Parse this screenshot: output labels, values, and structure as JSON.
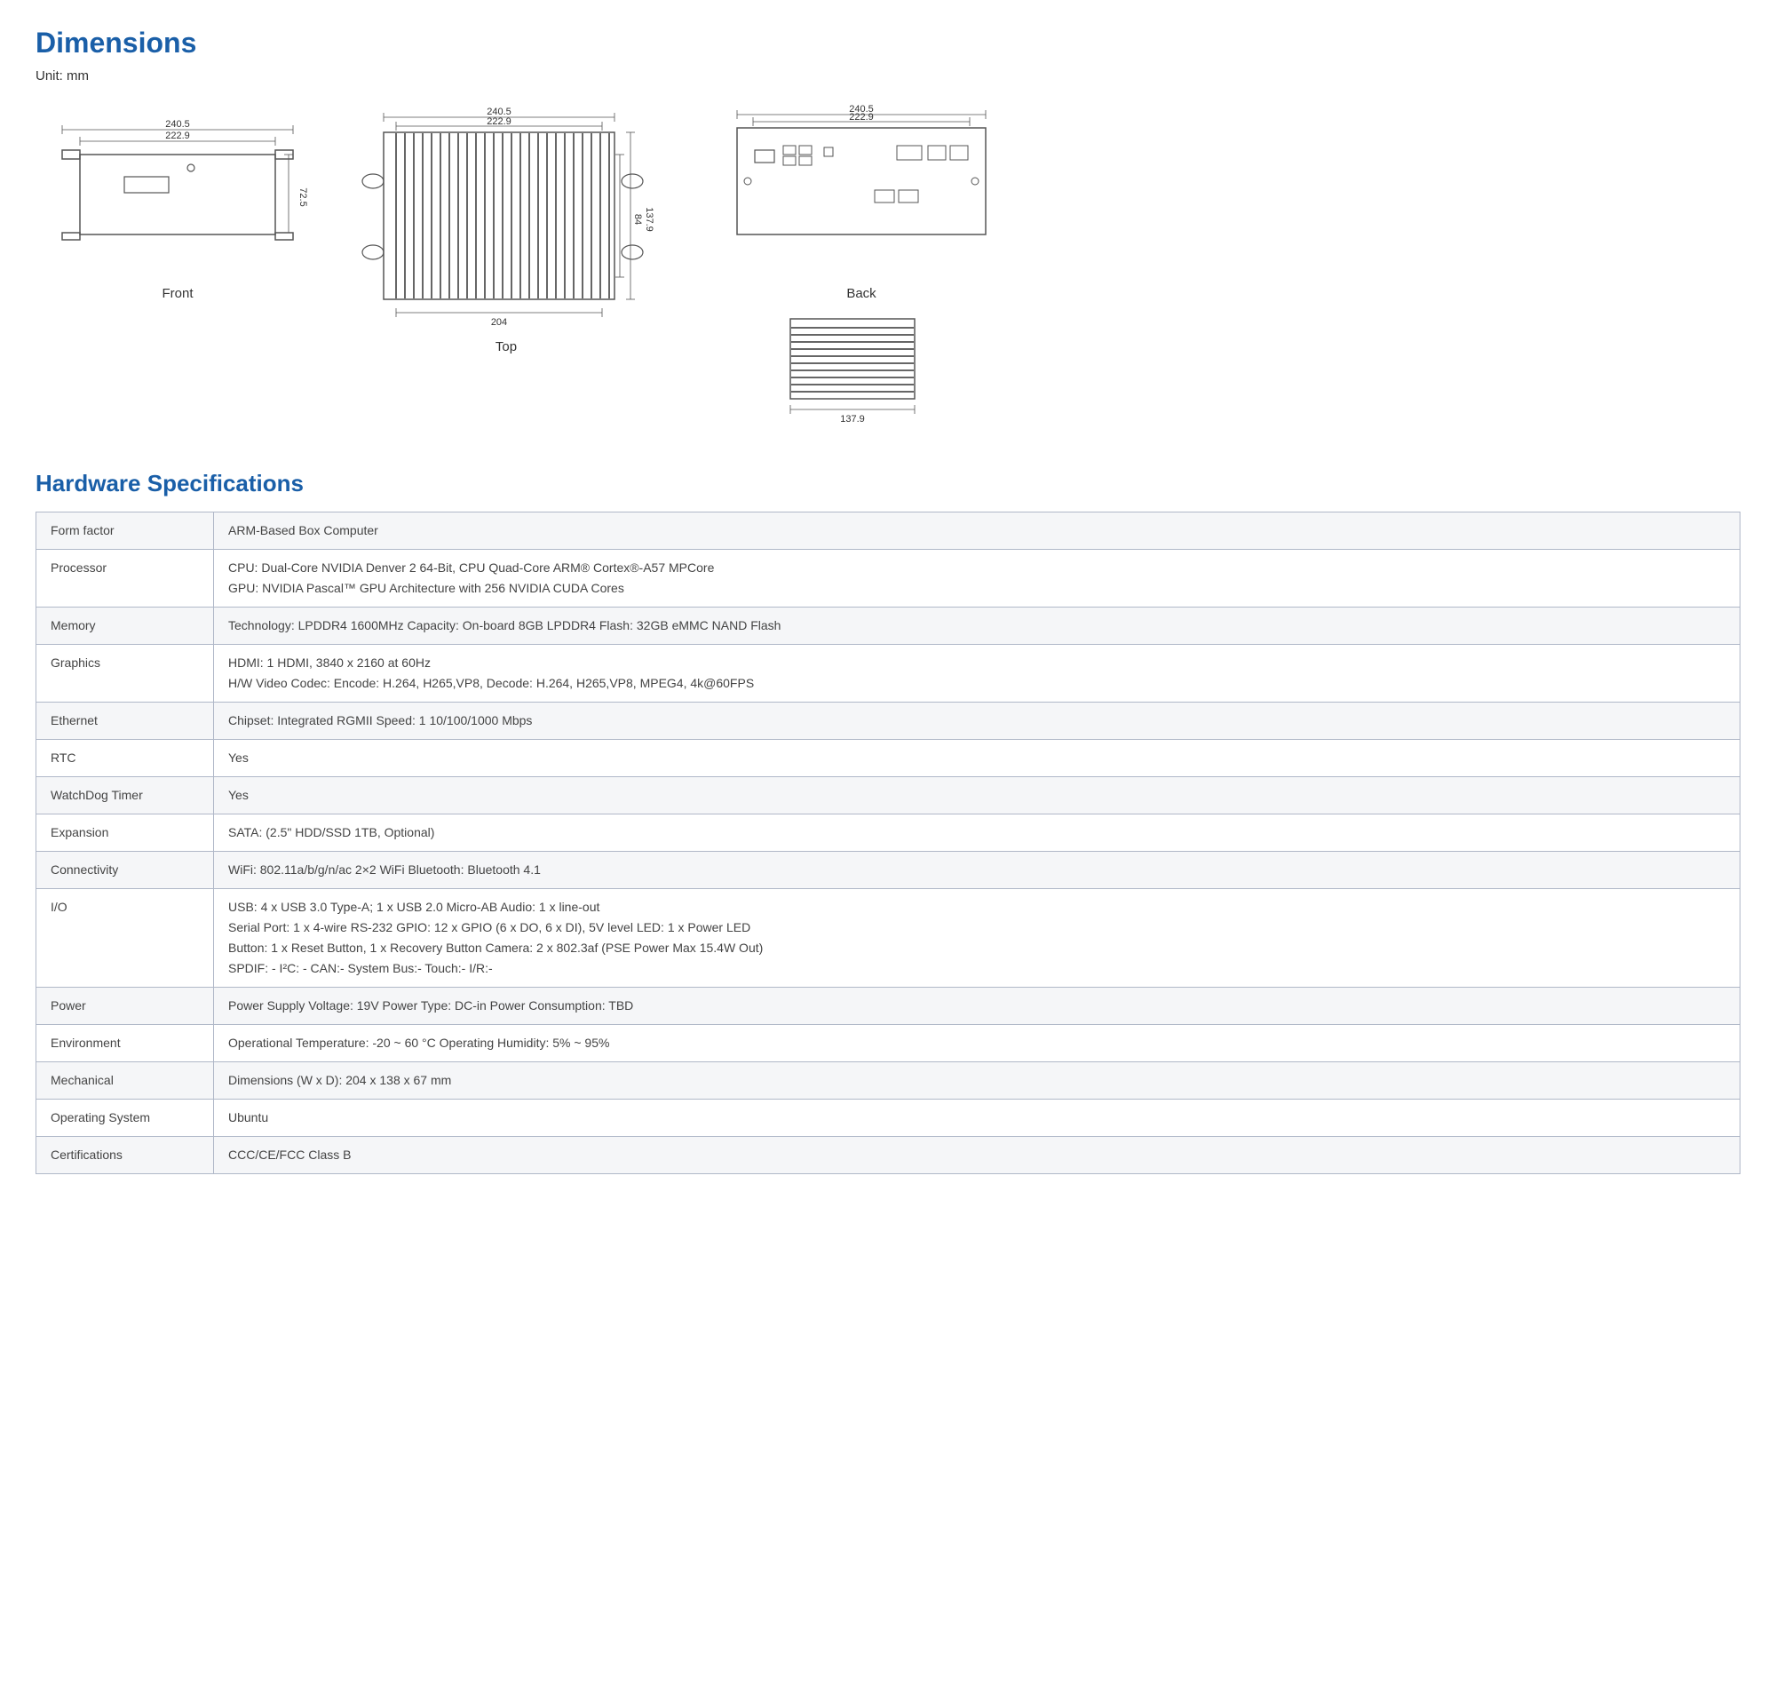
{
  "dimensions": {
    "title": "Dimensions",
    "unit": "Unit: mm",
    "diagrams": [
      {
        "id": "front",
        "label": "Front"
      },
      {
        "id": "top",
        "label": "Top"
      },
      {
        "id": "back",
        "label": "Back"
      },
      {
        "id": "side",
        "label": ""
      }
    ],
    "measurements": {
      "front": {
        "width1": "222.9",
        "width2": "240.5",
        "height": "72.5"
      },
      "top": {
        "width1": "222.9",
        "width2": "240.5",
        "depth1": "204",
        "depth2": "137.9",
        "height2": "84"
      },
      "back": {
        "width1": "222.9",
        "width2": "240.5"
      },
      "side": {
        "depth": "137.9"
      }
    }
  },
  "specs": {
    "title": "Hardware Specifications",
    "rows": [
      {
        "label": "Form factor",
        "values": [
          "ARM-Based Box Computer"
        ]
      },
      {
        "label": "Processor",
        "values": [
          "CPU: Dual-Core NVIDIA Denver 2 64-Bit, CPU Quad-Core ARM® Cortex®-A57 MPCore",
          "GPU: NVIDIA Pascal™ GPU Architecture with 256 NVIDIA CUDA Cores"
        ]
      },
      {
        "label": "Memory",
        "values": [
          "Technology: LPDDR4 1600MHz      Capacity: On-board 8GB LPDDR4      Flash: 32GB eMMC NAND Flash"
        ]
      },
      {
        "label": "Graphics",
        "values": [
          "HDMI: 1 HDMI, 3840 x 2160 at 60Hz",
          "H/W Video Codec: Encode: H.264, H265,VP8,  Decode: H.264, H265,VP8, MPEG4, 4k@60FPS"
        ]
      },
      {
        "label": "Ethernet",
        "values": [
          "Chipset: Integrated RGMII      Speed: 1 10/100/1000 Mbps"
        ]
      },
      {
        "label": "RTC",
        "values": [
          "Yes"
        ]
      },
      {
        "label": "WatchDog Timer",
        "values": [
          "Yes"
        ]
      },
      {
        "label": "Expansion",
        "values": [
          "SATA: (2.5\" HDD/SSD 1TB, Optional)"
        ]
      },
      {
        "label": "Connectivity",
        "values": [
          "WiFi: 802.11a/b/g/n/ac 2×2  WiFi      Bluetooth: Bluetooth 4.1"
        ]
      },
      {
        "label": "I/O",
        "values": [
          "USB: 4 x USB 3.0 Type-A; 1 x USB 2.0 Micro-AB    Audio: 1 x line-out",
          "Serial Port: 1 x 4-wire RS-232     GPIO: 12 x GPIO (6 x DO, 6 x DI), 5V level      LED: 1 x Power LED",
          "Button: 1 x Reset Button, 1 x Recovery Button      Camera: 2 x 802.3af (PSE Power Max 15.4W Out)",
          "SPDIF: -   I²C: -   CAN:-   System Bus:-   Touch:-   I/R:-"
        ]
      },
      {
        "label": "Power",
        "values": [
          "Power Supply Voltage: 19V    Power Type: DC-in    Power Consumption: TBD"
        ]
      },
      {
        "label": "Environment",
        "values": [
          "Operational Temperature: -20 ~ 60 °C      Operating Humidity: 5% ~ 95%"
        ]
      },
      {
        "label": "Mechanical",
        "values": [
          "Dimensions (W x D): 204  x 138 x 67 mm"
        ]
      },
      {
        "label": "Operating System",
        "values": [
          "Ubuntu"
        ]
      },
      {
        "label": "Certifications",
        "values": [
          "CCC/CE/FCC Class B"
        ]
      }
    ]
  }
}
